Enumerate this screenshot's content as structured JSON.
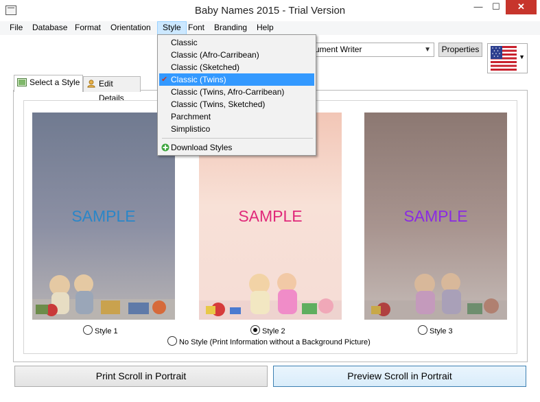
{
  "window": {
    "title": "Baby Names 2015 - Trial Version",
    "min_glyph": "—",
    "max_glyph": "☐",
    "close_glyph": "✕"
  },
  "menubar": [
    "File",
    "Database",
    "Format",
    "Orientation",
    "Style",
    "Font",
    "Branding",
    "Help"
  ],
  "active_menu": "Style",
  "style_menu": {
    "items": [
      "Classic",
      "Classic (Afro-Carribean)",
      "Classic (Sketched)",
      "Classic (Twins)",
      "Classic (Twins, Afro-Carribean)",
      "Classic (Twins, Sketched)",
      "Parchment",
      "Simplistico"
    ],
    "selected": "Classic (Twins)",
    "download_label": "Download Styles"
  },
  "printer": {
    "selected_visible": "cument Writer",
    "properties_label": "Properties",
    "language_flag": "us-flag-icon"
  },
  "tabs": [
    {
      "label": "Select a Style",
      "active": true
    },
    {
      "label": "Edit Details",
      "active": false
    }
  ],
  "styles": {
    "previews": [
      {
        "sample_text": "SAMPLE",
        "sample_color": "#2a86c8"
      },
      {
        "sample_text": "SAMPLE",
        "sample_color": "#e0287a"
      },
      {
        "sample_text": "SAMPLE",
        "sample_color": "#8a2be2"
      }
    ],
    "radios": [
      {
        "label": "Style 1",
        "checked": false
      },
      {
        "label": "Style 2",
        "checked": true
      },
      {
        "label": "Style 3",
        "checked": false
      },
      {
        "label": "No Style (Print Information without a Background Picture)",
        "checked": false
      }
    ]
  },
  "buttons": {
    "print_label": "Print Scroll in Portrait",
    "preview_label": "Preview Scroll in Portrait"
  },
  "colors": {
    "menu_highlight": "#3399ff",
    "close_button": "#c7352c"
  }
}
